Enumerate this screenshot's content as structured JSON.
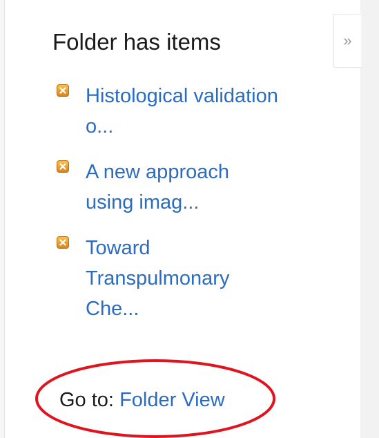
{
  "panel": {
    "title": "Folder has items",
    "collapse_glyph": "»",
    "items": [
      {
        "label_line1": "Histological validation",
        "label_line2": "o...",
        "icon": "orange-x-icon"
      },
      {
        "label_line1": "A new approach",
        "label_line2": "using imag...",
        "icon": "orange-x-icon"
      },
      {
        "label_line1": "Toward",
        "label_line2": "Transpulmonary",
        "label_line3": "Che...",
        "icon": "orange-x-icon"
      }
    ],
    "goto_prefix": "Go to:",
    "goto_link": "Folder View"
  },
  "colors": {
    "link": "#2a6cc1",
    "text": "#1a1a1a",
    "highlight": "#e0141e",
    "icon": "#e89a2c"
  }
}
